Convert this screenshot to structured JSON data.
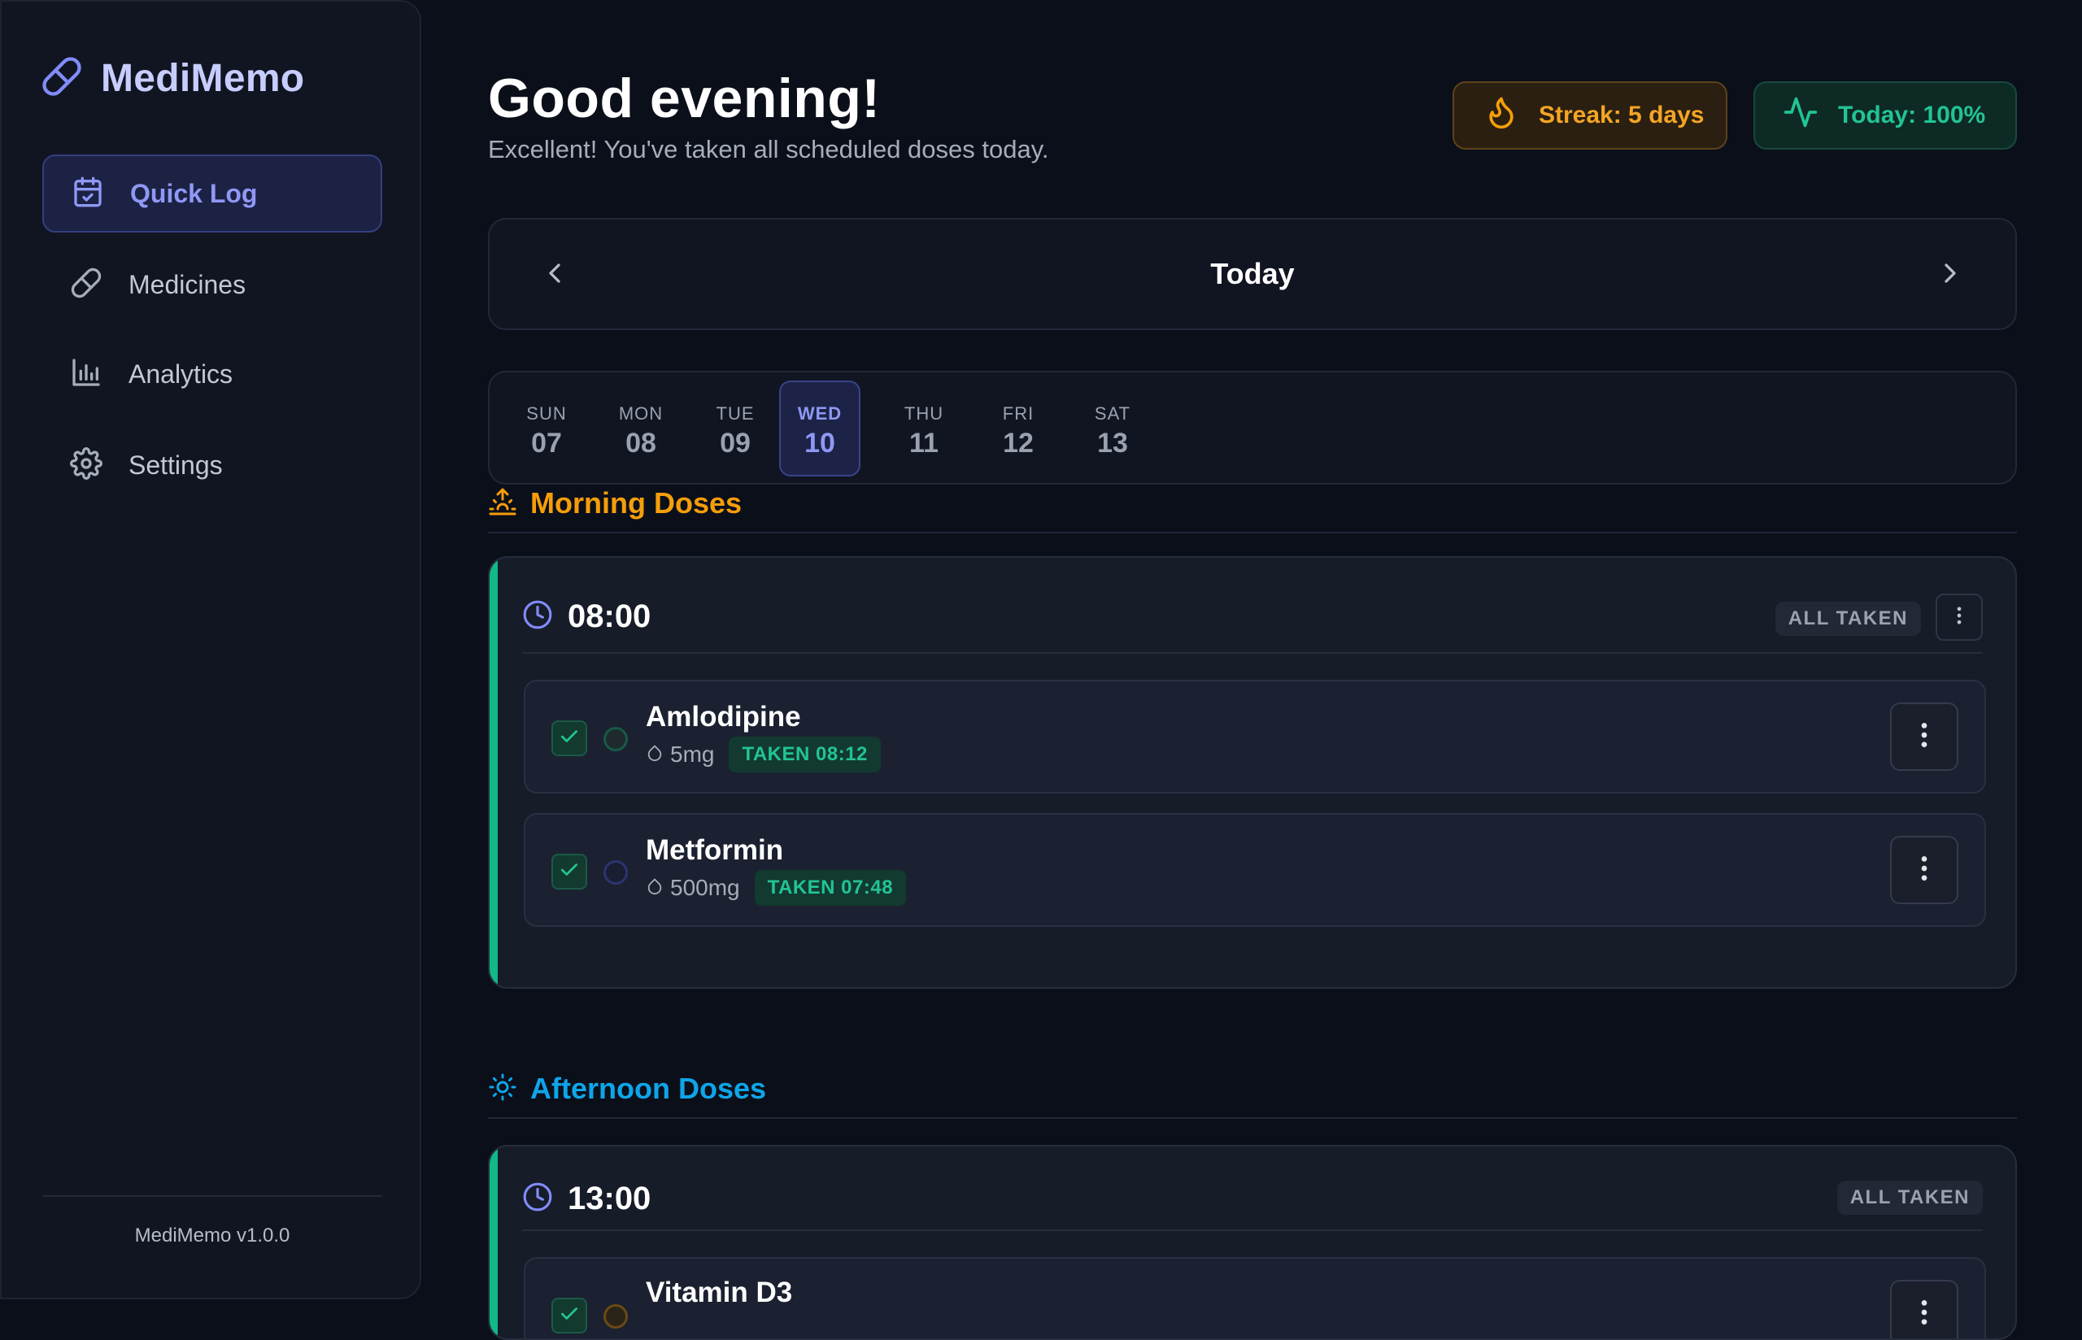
{
  "app": {
    "name": "MediMemo",
    "version": "MediMemo v1.0.0"
  },
  "sidebar": {
    "items": [
      {
        "label": "Quick Log",
        "icon": "calendar-check-icon",
        "active": true
      },
      {
        "label": "Medicines",
        "icon": "pill-icon",
        "active": false
      },
      {
        "label": "Analytics",
        "icon": "bar-chart-icon",
        "active": false
      },
      {
        "label": "Settings",
        "icon": "gear-icon",
        "active": false
      }
    ]
  },
  "header": {
    "greeting": "Good evening!",
    "subtitle": "Excellent! You've taken all scheduled doses today.",
    "streak": "Streak: 5 days",
    "today": "Today: 100%"
  },
  "date_nav": {
    "title": "Today"
  },
  "week": [
    {
      "name": "SUN",
      "num": "07",
      "active": false
    },
    {
      "name": "MON",
      "num": "08",
      "active": false
    },
    {
      "name": "TUE",
      "num": "09",
      "active": false
    },
    {
      "name": "WED",
      "num": "10",
      "active": true
    },
    {
      "name": "THU",
      "num": "11",
      "active": false
    },
    {
      "name": "FRI",
      "num": "12",
      "active": false
    },
    {
      "name": "SAT",
      "num": "13",
      "active": false
    }
  ],
  "sections": [
    {
      "title": "Morning Doses",
      "color": "#f59e0b",
      "groups": [
        {
          "time": "08:00",
          "status": "ALL TAKEN",
          "meds": [
            {
              "name": "Amlodipine",
              "dose": "5mg",
              "status": "TAKEN 08:12"
            },
            {
              "name": "Metformin",
              "dose": "500mg",
              "status": "TAKEN 07:48"
            }
          ]
        }
      ]
    },
    {
      "title": "Afternoon Doses",
      "color": "#0ea5e9",
      "groups": [
        {
          "time": "13:00",
          "status": "ALL TAKEN",
          "meds": [
            {
              "name": "Vitamin D3"
            }
          ]
        }
      ]
    }
  ],
  "colors": {
    "accent": "#8f98f5",
    "success": "#22c493",
    "warning": "#f5a524",
    "background": "#0b0f19"
  }
}
